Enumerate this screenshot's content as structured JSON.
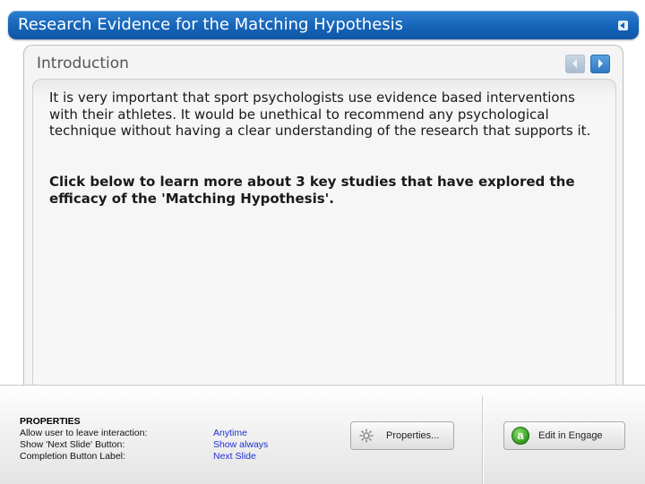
{
  "header": {
    "title": "Research Evidence for the Matching Hypothesis"
  },
  "slide": {
    "heading": "Introduction",
    "paragraph": "It is very important that sport psychologists use evidence based interventions with their athletes. It would be unethical to recommend any psychological technique without having a clear understanding of the research that supports it.",
    "call_to_action": "Click below to learn more about 3 key studies that have explored the efficacy of the 'Matching Hypothesis'."
  },
  "properties": {
    "title": "PROPERTIES",
    "rows": [
      {
        "label": "Allow user to leave interaction:",
        "value": "Anytime"
      },
      {
        "label": "Show 'Next Slide' Button:",
        "value": "Show always"
      },
      {
        "label": "Completion Button Label:",
        "value": "Next Slide"
      }
    ],
    "properties_button": "Properties...",
    "engage_button": "Edit in Engage",
    "engage_icon_letter": "a"
  },
  "colors": {
    "title_bar": "#1564b8",
    "property_value": "#1f2fd0",
    "next_button": "#2f78c4"
  }
}
